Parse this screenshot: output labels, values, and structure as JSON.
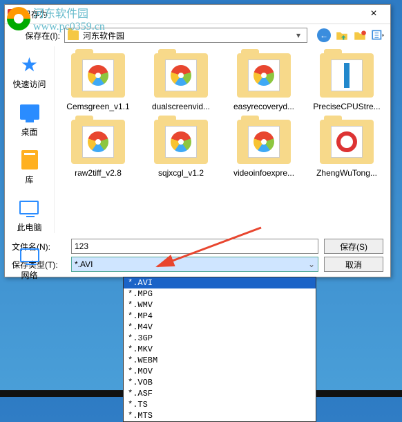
{
  "window": {
    "title": "另存为"
  },
  "watermark": {
    "text_a": "河东软件园",
    "text_b": "www.pc0359.cn"
  },
  "toolbar": {
    "save_in_label": "保存在(I):",
    "current_dir": "河东软件园"
  },
  "sidebar": {
    "items": [
      {
        "label": "快速访问"
      },
      {
        "label": "桌面"
      },
      {
        "label": "库"
      },
      {
        "label": "此电脑"
      },
      {
        "label": "网络"
      }
    ]
  },
  "files": [
    {
      "name": "Cemsgreen_v1.1",
      "kind": "pinwheel"
    },
    {
      "name": "dualscreenvid...",
      "kind": "pinwheel"
    },
    {
      "name": "easyrecoveryd...",
      "kind": "pinwheel"
    },
    {
      "name": "PreciseCPUStre...",
      "kind": "bluebar"
    },
    {
      "name": "raw2tiff_v2.8",
      "kind": "pinwheel"
    },
    {
      "name": "sqjxcgl_v1.2",
      "kind": "pinwheel"
    },
    {
      "name": "videoinfoexpre...",
      "kind": "pinwheel"
    },
    {
      "name": "ZhengWuTong...",
      "kind": "redcircle"
    }
  ],
  "fields": {
    "filename_label": "文件名(N):",
    "filename_value": "123",
    "type_label": "保存类型(T):",
    "type_value": "*.AVI"
  },
  "buttons": {
    "save": "保存(S)",
    "cancel": "取消"
  },
  "type_options": [
    "*.AVI",
    "*.MPG",
    "*.WMV",
    "*.MP4",
    "*.M4V",
    "*.3GP",
    "*.MKV",
    "*.WEBM",
    "*.MOV",
    "*.VOB",
    "*.ASF",
    "*.TS",
    "*.MTS"
  ]
}
